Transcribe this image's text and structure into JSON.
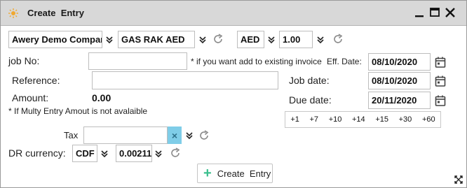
{
  "window": {
    "title": "Create  Entry"
  },
  "top_row": {
    "company": "Awery Demo Compan",
    "account": "GAS RAK AED",
    "currency": "AED",
    "rate": "1.00"
  },
  "form": {
    "job_no_label": "job No:",
    "job_no_value": "",
    "job_no_hint": "* if you want add to existing invoice",
    "eff_date_label": "Eff. Date:",
    "eff_date_value": "08/10/2020",
    "reference_label": "Reference:",
    "reference_value": "",
    "job_date_label": "Job date:",
    "job_date_value": "08/10/2020",
    "amount_label": "Amount:",
    "amount_value": "0.00",
    "due_date_label": "Due date:",
    "due_date_value": "20/11/2020",
    "multi_entry_note": "* If Multy Entry Amout is not avalaible",
    "tax_label": "Tax",
    "tax_value": "",
    "dr_currency_label": "DR currency:",
    "dr_currency_code": "CDF",
    "dr_currency_rate": "0.00211"
  },
  "quick_days": [
    "+1",
    "+7",
    "+10",
    "+14",
    "+15",
    "+30",
    "+60"
  ],
  "actions": {
    "create_label": "Create  Entry"
  },
  "colors": {
    "accent": "#3bbf8e",
    "titlebar": "#d8d8d8",
    "clear_button": "#7fcde8",
    "app_icon": "#f0a830"
  }
}
